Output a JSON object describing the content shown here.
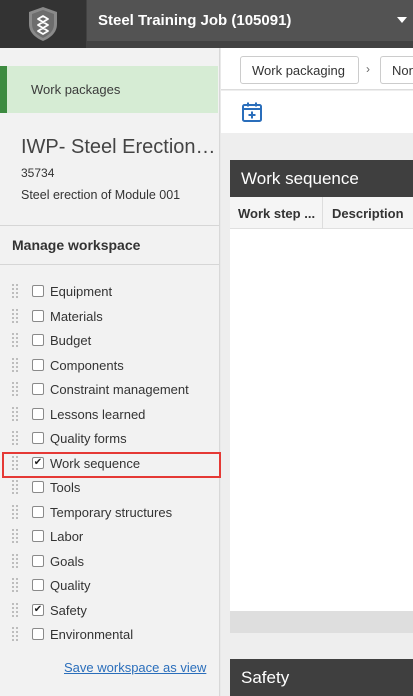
{
  "app": {
    "logo_icon": "app-logo-icon",
    "job_name": "Steel Training Job (105091)"
  },
  "left": {
    "work_packages_tab": "Work packages",
    "iwp_title": "IWP- Steel Erection ...",
    "iwp_id": "35734",
    "iwp_description": "Steel erection of Module 001",
    "manage_title": "Manage workspace",
    "items": [
      {
        "label": "Equipment",
        "checked": false
      },
      {
        "label": "Materials",
        "checked": false
      },
      {
        "label": "Budget",
        "checked": false
      },
      {
        "label": "Components",
        "checked": false
      },
      {
        "label": "Constraint management",
        "checked": false
      },
      {
        "label": "Lessons learned",
        "checked": false
      },
      {
        "label": "Quality forms",
        "checked": false
      },
      {
        "label": "Work sequence",
        "checked": true,
        "highlighted": true
      },
      {
        "label": "Tools",
        "checked": false
      },
      {
        "label": "Temporary structures",
        "checked": false
      },
      {
        "label": "Labor",
        "checked": false
      },
      {
        "label": "Goals",
        "checked": false
      },
      {
        "label": "Quality",
        "checked": false
      },
      {
        "label": "Safety",
        "checked": true
      },
      {
        "label": "Environmental",
        "checked": false
      }
    ],
    "save_link": "Save workspace as view"
  },
  "right": {
    "breadcrumbs": [
      "Work packaging",
      "Non"
    ],
    "breadcrumb_separator": "›",
    "calendar_icon": "calendar-add-icon",
    "work_sequence": {
      "title": "Work sequence",
      "columns": [
        "Work step ...",
        "Description"
      ]
    },
    "safety": {
      "title": "Safety"
    }
  },
  "colors": {
    "topbar": "#424242",
    "job_select": "#535353",
    "tab_active_bg": "#d6ecd4",
    "tab_active_border": "#3d8b40",
    "card_header": "#3f3f3f",
    "highlight": "#e53935",
    "link": "#2a6ebb",
    "calendar_icon": "#2a6ebb"
  }
}
